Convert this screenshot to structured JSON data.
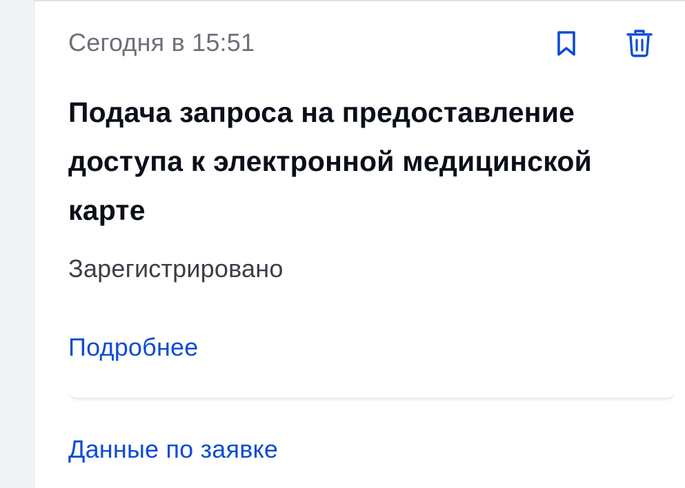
{
  "card": {
    "timestamp": "Сегодня в 15:51",
    "title": "Подача запроса на предоставление доступа к электронной медицинской карте",
    "status": "Зарегистрировано",
    "details_link": "Подробнее"
  },
  "actions": {
    "bookmark_icon": "bookmark-icon",
    "delete_icon": "trash-icon"
  },
  "request_data_link": "Данные по заявке",
  "colors": {
    "accent": "#0d4cd3",
    "muted_text": "#6b7079",
    "title_text": "#0b0f19"
  }
}
